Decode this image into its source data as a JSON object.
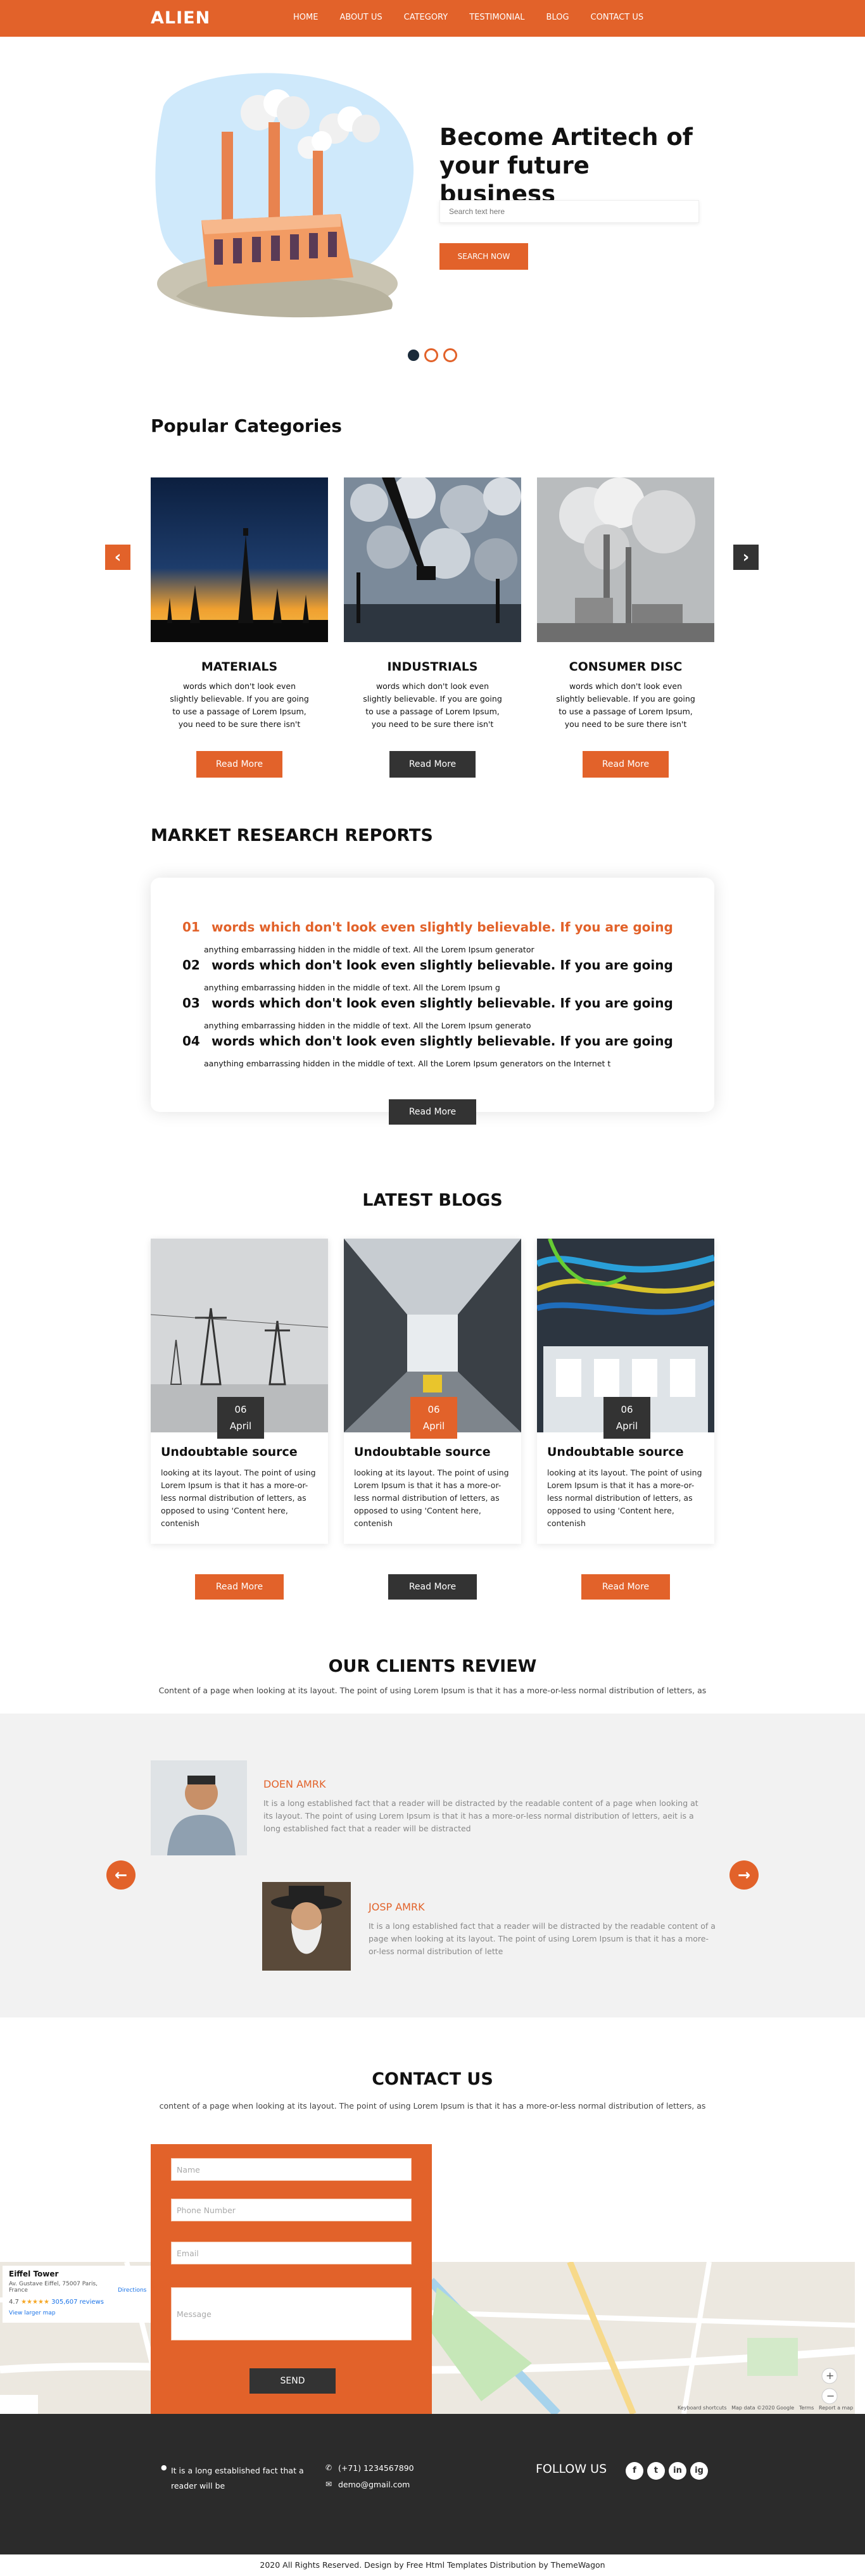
{
  "header": {
    "logo": "ALIEN",
    "nav": [
      "HOME",
      "ABOUT US",
      "CATEGORY",
      "TESTIMONIAL",
      "BLOG",
      "CONTACT US"
    ]
  },
  "hero": {
    "title_line1": "Become Artitech of",
    "title_line2": "your future business",
    "search_placeholder": "Search text here",
    "button": "SEARCH NOW"
  },
  "categories": {
    "title": "Popular Categories",
    "items": [
      {
        "title": "MATERIALS",
        "text": "words which don't look even slightly believable. If you are going to use a passage of Lorem Ipsum, you need to be sure there isn't",
        "button": "Read More"
      },
      {
        "title": "INDUSTRIALS",
        "text": "words which don't look even slightly believable. If you are going to use a passage of Lorem Ipsum, you need to be sure there isn't",
        "button": "Read More"
      },
      {
        "title": "CONSUMER DISC",
        "text": "words which don't look even slightly believable. If you are going to use a passage of Lorem Ipsum, you need to be sure there isn't",
        "button": "Read More"
      }
    ]
  },
  "market": {
    "title": "MARKET RESEARCH REPORTS",
    "items": [
      {
        "num": "01",
        "heading": "words which don't look even slightly believable. If you are going",
        "sub": "anything embarrassing hidden in the middle of text. All the Lorem Ipsum generator"
      },
      {
        "num": "02",
        "heading": "words which don't look even slightly believable. If you are going",
        "sub": "anything embarrassing hidden in the middle of text. All the Lorem Ipsum g"
      },
      {
        "num": "03",
        "heading": "words which don't look even slightly believable. If you are going",
        "sub": "anything embarrassing hidden in the middle of text. All the Lorem Ipsum generato"
      },
      {
        "num": "04",
        "heading": "words which don't look even slightly believable. If you are going",
        "sub": "aanything embarrassing hidden in the middle of text. All the Lorem Ipsum generators on the Internet t"
      }
    ],
    "button": "Read More"
  },
  "blogs": {
    "title": "LATEST BLOGS",
    "items": [
      {
        "day": "06",
        "month": "April",
        "title": "Undoubtable source",
        "text": "looking at its layout. The point of using Lorem Ipsum is that it has a more-or-less normal distribution of letters, as opposed to using 'Content here, contenish",
        "button": "Read More"
      },
      {
        "day": "06",
        "month": "April",
        "title": "Undoubtable source",
        "text": "looking at its layout. The point of using Lorem Ipsum is that it has a more-or-less normal distribution of letters, as opposed to using 'Content here, contenish",
        "button": "Read More"
      },
      {
        "day": "06",
        "month": "April",
        "title": "Undoubtable source",
        "text": "looking at its layout. The point of using Lorem Ipsum is that it has a more-or-less normal distribution of letters, as opposed to using 'Content here, contenish",
        "button": "Read More"
      }
    ]
  },
  "reviews": {
    "title": "OUR CLIENTS REVIEW",
    "lead": "Content of a page when looking at its layout. The point of using Lorem Ipsum is that it has a more-or-less normal distribution of letters, as",
    "items": [
      {
        "name": "DOEN AMRK",
        "text": "It is a long established fact that a reader will be distracted by the readable content of a page when looking at its layout. The point of using Lorem Ipsum is that it has a more-or-less normal distribution of letters, aeit is a long established fact that a reader will be distracted"
      },
      {
        "name": "JOSP AMRK",
        "text": "It is a long established fact that a reader will be distracted by the readable content of a page when looking at its layout. The point of using Lorem Ipsum is that it has a more-or-less normal distribution of lette"
      }
    ]
  },
  "contact": {
    "title": "CONTACT US",
    "lead": "content of a page when looking at its layout. The point of using Lorem Ipsum is that it has a more-or-less normal distribution of letters, as",
    "fields": [
      "Name",
      "Phone Number",
      "Email",
      "Message"
    ],
    "button": "SEND"
  },
  "map": {
    "place_title": "Eiffel Tower",
    "place_address": "Av. Gustave Eiffel, 75007 Paris, France",
    "rating": "4.7",
    "stars": "★★★★★",
    "reviews": "305,607 reviews",
    "directions": "Directions",
    "larger_map": "View larger map",
    "footer_terms": "Keyboard shortcuts   Map data ©2020 Google   Terms   Report a map error"
  },
  "footer": {
    "address": "It is a long established fact that a reader will be",
    "phone": "(+71) 1234567890",
    "email": "demo@gmail.com",
    "follow": "FOLLOW US",
    "social": [
      "f",
      "t",
      "in",
      "ig"
    ],
    "copyright": "2020 All Rights Reserved. Design by Free Html Templates Distribution by ThemeWagon"
  },
  "colors": {
    "accent": "#e2622a",
    "dark": "#333333",
    "footer": "#2b2b2b"
  }
}
